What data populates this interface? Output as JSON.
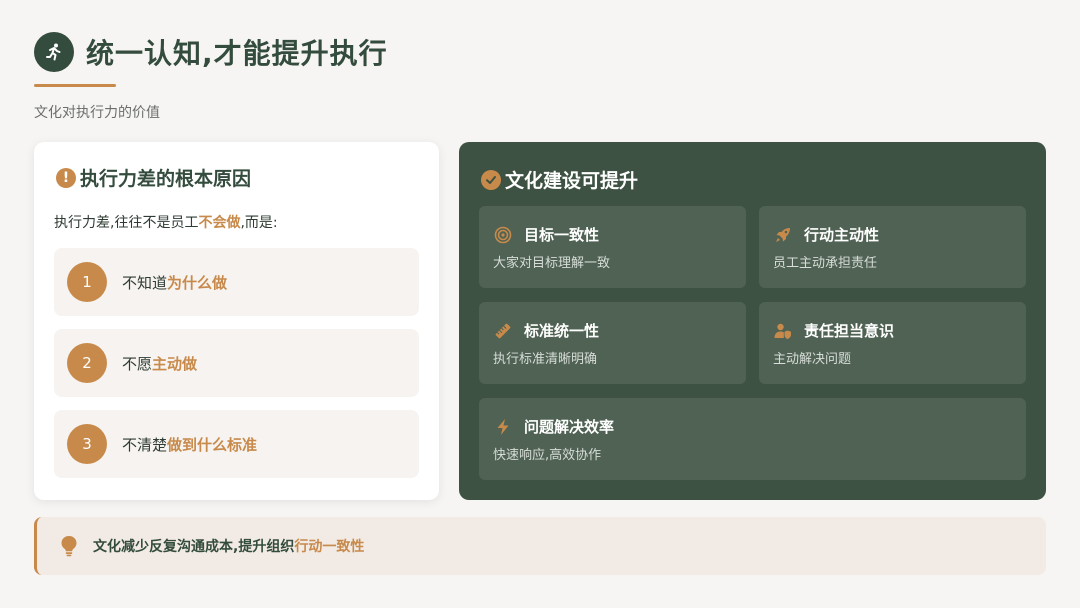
{
  "header": {
    "title": "统一认知,才能提升执行",
    "subtitle": "文化对执行力的价值",
    "icon": "running-person-icon"
  },
  "left_card": {
    "title": "执行力差的根本原因",
    "desc_prefix": "执行力差,往往不是员工",
    "desc_highlight": "不会做",
    "desc_suffix": ",而是:",
    "reasons": [
      {
        "num": "1",
        "prefix": "不知道",
        "highlight": "为什么做"
      },
      {
        "num": "2",
        "prefix": "不愿",
        "highlight": "主动做"
      },
      {
        "num": "3",
        "prefix": "不清楚",
        "highlight": "做到什么标准"
      }
    ]
  },
  "right_card": {
    "title": "文化建设可提升",
    "items": [
      {
        "title": "目标一致性",
        "desc": "大家对目标理解一致",
        "icon": "target-icon"
      },
      {
        "title": "行动主动性",
        "desc": "员工主动承担责任",
        "icon": "rocket-icon"
      },
      {
        "title": "标准统一性",
        "desc": "执行标准清晰明确",
        "icon": "ruler-icon"
      },
      {
        "title": "责任担当意识",
        "desc": "主动解决问题",
        "icon": "user-shield-icon"
      },
      {
        "title": "问题解决效率",
        "desc": "快速响应,高效协作",
        "icon": "lightning-icon"
      }
    ]
  },
  "banner": {
    "prefix": "文化减少反复沟通成本,提升组织",
    "highlight": "行动一致性",
    "icon": "lightbulb-icon"
  },
  "colors": {
    "primary_green": "#344c3d",
    "card_green": "#3d5242",
    "accent_orange": "#c88a4b"
  }
}
